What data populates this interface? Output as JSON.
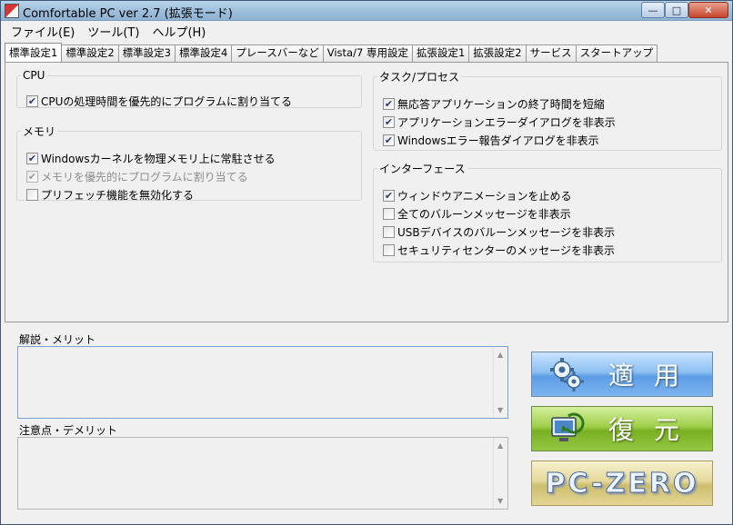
{
  "window": {
    "title": "Comfortable PC ver 2.7 (拡張モード)"
  },
  "titlebar_buttons": {
    "minimize": "—",
    "maximize": "□",
    "close": "✕"
  },
  "menu": [
    {
      "label": "ファイル(E)"
    },
    {
      "label": "ツール(T)"
    },
    {
      "label": "ヘルプ(H)"
    }
  ],
  "tabs": [
    {
      "label": "標準設定1",
      "active": true
    },
    {
      "label": "標準設定2"
    },
    {
      "label": "標準設定3"
    },
    {
      "label": "標準設定4"
    },
    {
      "label": "プレースバーなど"
    },
    {
      "label": "Vista/7 専用設定"
    },
    {
      "label": "拡張設定1"
    },
    {
      "label": "拡張設定2"
    },
    {
      "label": "サービス"
    },
    {
      "label": "スタートアップ"
    }
  ],
  "cpu": {
    "title": "CPU",
    "options": [
      {
        "label": "CPUの処理時間を優先的にプログラムに割り当てる",
        "checked": true,
        "check": "✔"
      }
    ]
  },
  "memory": {
    "title": "メモリ",
    "options": [
      {
        "label": "Windowsカーネルを物理メモリ上に常駐させる",
        "checked": true,
        "check": "✔"
      },
      {
        "label": "メモリを優先的にプログラムに割り当てる",
        "checked": true,
        "disabled": true,
        "check": "✔"
      },
      {
        "label": "プリフェッチ機能を無効化する",
        "checked": false,
        "check": ""
      }
    ]
  },
  "task": {
    "title": "タスク/プロセス",
    "options": [
      {
        "label": "無応答アプリケーションの終了時間を短縮",
        "checked": true,
        "check": "✔"
      },
      {
        "label": "アプリケーションエラーダイアログを非表示",
        "checked": true,
        "check": "✔"
      },
      {
        "label": "Windowsエラー報告ダイアログを非表示",
        "checked": true,
        "check": "✔"
      }
    ]
  },
  "interface": {
    "title": "インターフェース",
    "options": [
      {
        "label": "ウィンドウアニメーションを止める",
        "checked": true,
        "check": "✔"
      },
      {
        "label": "全てのバルーンメッセージを非表示",
        "checked": false,
        "check": ""
      },
      {
        "label": "USBデバイスのバルーンメッセージを非表示",
        "checked": false,
        "check": ""
      },
      {
        "label": "セキュリティセンターのメッセージを非表示",
        "checked": false,
        "check": ""
      }
    ]
  },
  "explanation": {
    "title": "解説・メリット",
    "text": ""
  },
  "caution": {
    "title": "注意点・デメリット",
    "text": ""
  },
  "scroll_arrows": {
    "up": "▲",
    "down": "▼"
  },
  "buttons": {
    "apply": {
      "label": "適用",
      "icon": "gears-icon"
    },
    "restore": {
      "label": "復元",
      "icon": "restore-computer-icon"
    },
    "pczero": {
      "label": "PC-ZERO"
    }
  },
  "colors": {
    "apply_button": "#5d9de6",
    "restore_button": "#79b022",
    "pczero_button": "#cdbd6e"
  }
}
